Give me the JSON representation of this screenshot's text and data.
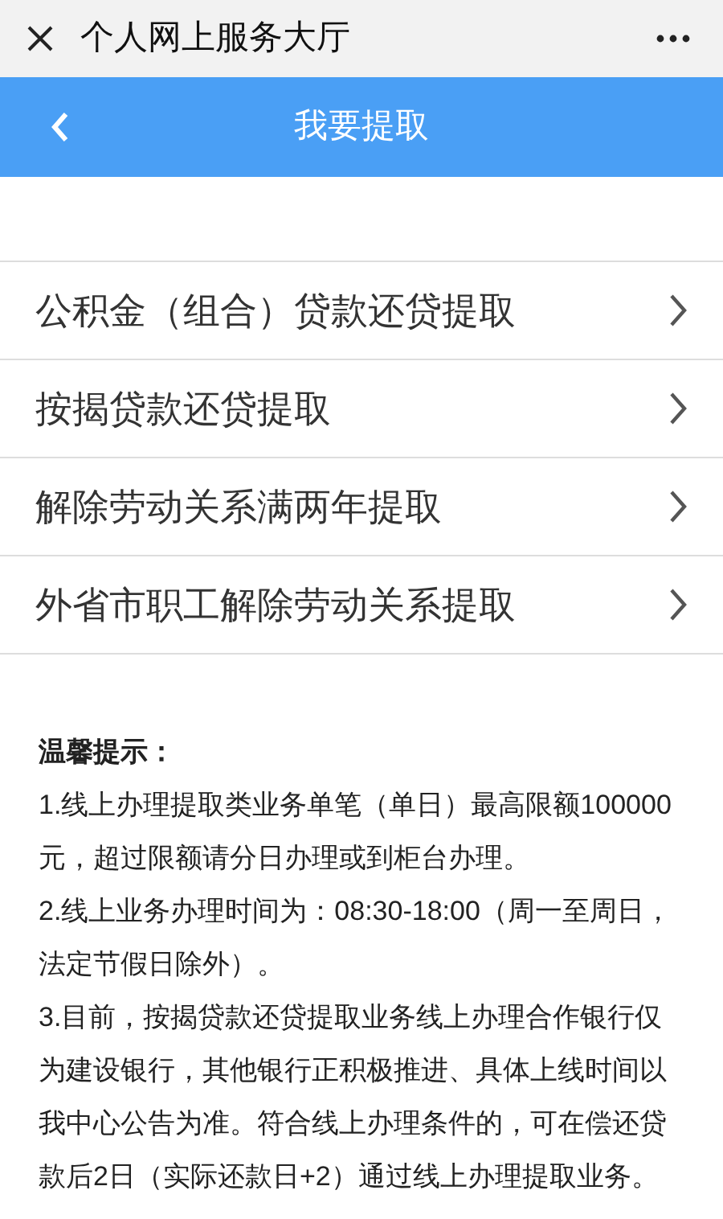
{
  "window": {
    "title": "个人网上服务大厅"
  },
  "header": {
    "title": "我要提取"
  },
  "menu": [
    {
      "label": "公积金（组合）贷款还贷提取"
    },
    {
      "label": "按揭贷款还贷提取"
    },
    {
      "label": "解除劳动关系满两年提取"
    },
    {
      "label": "外省市职工解除劳动关系提取"
    }
  ],
  "notice": {
    "heading": "温馨提示：",
    "items": [
      "1.线上办理提取类业务单笔（单日）最高限额100000元，超过限额请分日办理或到柜台办理。",
      "2.线上业务办理时间为：08:30-18:00（周一至周日，法定节假日除外）。",
      "3.目前，按揭贷款还贷提取业务线上办理合作银行仅为建设银行，其他银行正积极推进、具体上线时间以我中心公告为准。符合线上办理条件的，可在偿还贷款后2日（实际还款日+2）通过线上办理提取业务。"
    ]
  }
}
